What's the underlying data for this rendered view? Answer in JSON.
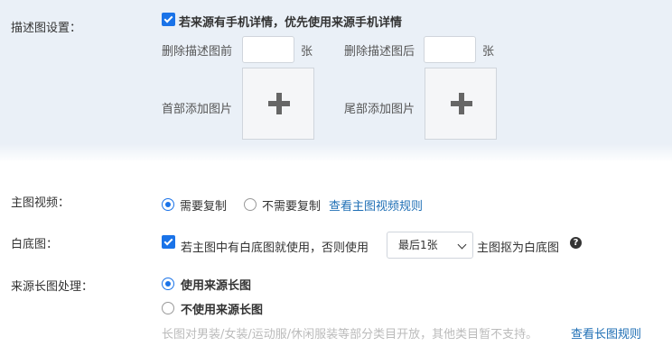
{
  "desc_settings": {
    "label": "描述图设置：",
    "prefer_mobile_label": "若来源有手机详情，优先使用来源手机详情",
    "prefer_mobile_checked": true,
    "delete_before_label": "删除描述图前",
    "delete_before_value": "",
    "delete_before_unit": "张",
    "delete_after_label": "删除描述图后",
    "delete_after_value": "",
    "delete_after_unit": "张",
    "add_header_label": "首部添加图片",
    "add_footer_label": "尾部添加图片"
  },
  "main_video": {
    "label": "主图视频：",
    "options": [
      "需要复制",
      "不需要复制"
    ],
    "selected": "需要复制",
    "rules_link": "查看主图视频规则"
  },
  "white_bg": {
    "label": "白底图：",
    "checked": true,
    "text_before": "若主图中有白底图就使用，否则使用",
    "select_value": "最后1张",
    "text_after": "主图抠为白底图",
    "help": "?"
  },
  "long_image": {
    "label": "来源长图处理：",
    "options": [
      "使用来源长图",
      "不使用来源长图"
    ],
    "selected": "使用来源长图",
    "note": "长图对男装/女装/运动服/休闲服装等部分类目开放，其他类目暂不支持。",
    "rules_link": "查看长图规则"
  },
  "colors": {
    "accent": "#1a73e8",
    "link": "#1f6fb5",
    "panel_bg": "#eaf0f7"
  }
}
